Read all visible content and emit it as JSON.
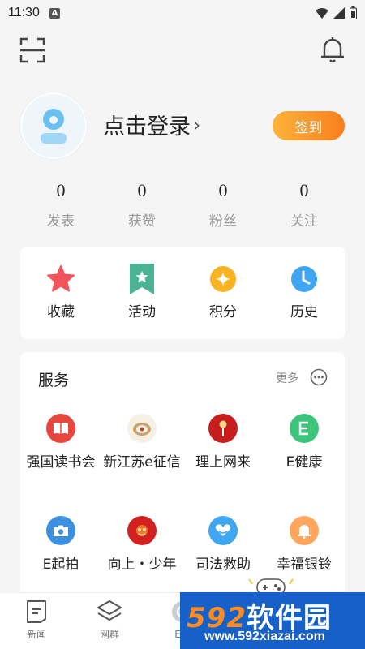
{
  "status_bar": {
    "time": "11:30",
    "badge": "A"
  },
  "header": {
    "scan_icon": "scan-icon",
    "bell_icon": "bell-icon"
  },
  "profile": {
    "login_label": "点击登录",
    "chevron": "›",
    "checkin_label": "签到"
  },
  "stats": [
    {
      "value": "0",
      "label": "发表"
    },
    {
      "value": "0",
      "label": "获赞"
    },
    {
      "value": "0",
      "label": "粉丝"
    },
    {
      "value": "0",
      "label": "关注"
    }
  ],
  "quick": [
    {
      "label": "收藏",
      "icon": "star-icon",
      "color": "#f2545b"
    },
    {
      "label": "活动",
      "icon": "bookmark-star-icon",
      "color": "#4ab394"
    },
    {
      "label": "积分",
      "icon": "diamond-coin-icon",
      "color": "#f7b321"
    },
    {
      "label": "历史",
      "icon": "clock-icon",
      "color": "#3fa6f2"
    }
  ],
  "services": {
    "title": "服务",
    "more_label": "更多",
    "items": [
      {
        "label": "强国读书会",
        "icon": "book-icon",
        "color": "#e8453c"
      },
      {
        "label": "新江苏e征信",
        "icon": "seal-icon",
        "color": "#c9a26b"
      },
      {
        "label": "理上网来",
        "icon": "microphone-icon",
        "color": "#c81d1d"
      },
      {
        "label": "E健康",
        "icon": "e-health-icon",
        "color": "#3cc47b"
      },
      {
        "label": "E起拍",
        "icon": "camera-icon",
        "color": "#3d8fe0"
      },
      {
        "label": "向上・少年",
        "icon": "youth-icon",
        "color": "#d32121"
      },
      {
        "label": "司法救助",
        "icon": "heart-hands-icon",
        "color": "#3fa6f2"
      },
      {
        "label": "幸福银铃",
        "icon": "bell-icon",
        "color": "#ffa55c"
      }
    ]
  },
  "bottom_nav": [
    {
      "label": "新闻",
      "icon": "news-icon"
    },
    {
      "label": "网群",
      "icon": "layers-icon"
    },
    {
      "label": "E起",
      "icon": "e-icon"
    }
  ],
  "watermark": {
    "brand_num": "592",
    "brand_text": "软件园",
    "url": "www.592xiazai.com"
  }
}
